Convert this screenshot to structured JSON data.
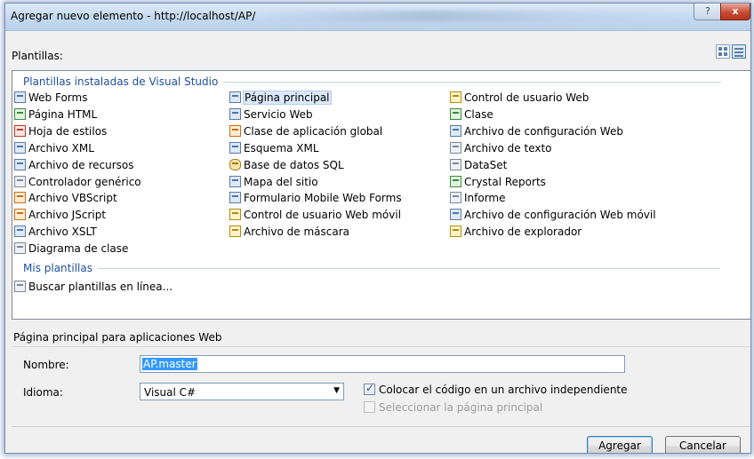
{
  "window": {
    "title": "Agregar nuevo elemento - http://localhost/AP/",
    "help_label": "?",
    "close_label": "x"
  },
  "templates": {
    "label": "Plantillas:",
    "groups": {
      "installed": "Plantillas instaladas de Visual Studio",
      "mine": "Mis plantillas"
    },
    "items": [
      "Web Forms",
      "Página principal",
      "Control de usuario Web",
      "Página HTML",
      "Servicio Web",
      "Clase",
      "Hoja de estilos",
      "Clase de aplicación global",
      "Archivo de configuración Web",
      "Archivo XML",
      "Esquema XML",
      "Archivo de texto",
      "Archivo de recursos",
      "Base de datos SQL",
      "DataSet",
      "Controlador genérico",
      "Mapa del sitio",
      "Crystal Reports",
      "Archivo VBScript",
      "Formulario Mobile Web Forms",
      "Informe",
      "Archivo JScript",
      "Control de usuario Web móvil",
      "Archivo de configuración Web móvil",
      "Archivo XSLT",
      "Archivo de máscara",
      "Archivo de explorador",
      "Diagrama de clase"
    ],
    "my_items": [
      "Buscar plantillas en línea..."
    ],
    "selected_item": "Página principal",
    "icons": [
      "web-forms-icon",
      "master-page-icon",
      "user-control-icon",
      "html-page-icon",
      "web-service-icon",
      "class-icon",
      "stylesheet-icon",
      "global-class-icon",
      "web-config-icon",
      "xml-file-icon",
      "xml-schema-icon",
      "text-file-icon",
      "resource-file-icon",
      "sql-database-icon",
      "dataset-icon",
      "generic-handler-icon",
      "site-map-icon",
      "crystal-reports-icon",
      "vbscript-icon",
      "mobile-web-form-icon",
      "report-icon",
      "jscript-icon",
      "mobile-user-control-icon",
      "mobile-web-config-icon",
      "xslt-file-icon",
      "skin-file-icon",
      "browser-file-icon",
      "class-diagram-icon"
    ]
  },
  "description": "Página principal para aplicaciones Web",
  "form": {
    "name_label": "Nombre:",
    "name_value": "AP.master",
    "language_label": "Idioma:",
    "language_value": "Visual C#",
    "checkbox_code_separate": "Colocar el código en un archivo independiente",
    "checkbox_code_separate_checked": true,
    "checkbox_select_master": "Seleccionar la página principal",
    "checkbox_select_master_checked": false
  },
  "buttons": {
    "add": "Agregar",
    "cancel": "Cancelar"
  },
  "colors": {
    "selection": "#3399ff",
    "group_header": "#1e50a0",
    "titlebar": "#c4d9ef"
  }
}
